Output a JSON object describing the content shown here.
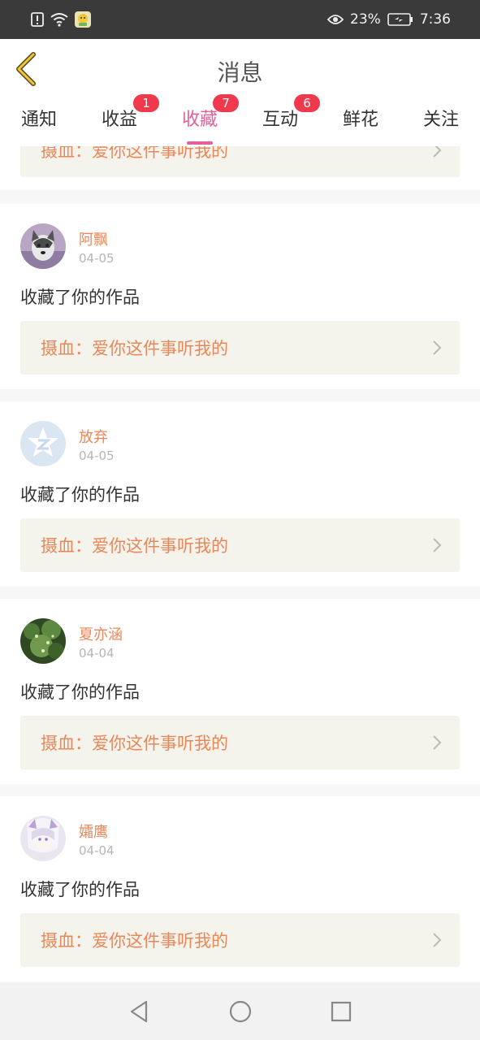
{
  "status_bar": {
    "battery": "23%",
    "time": "7:36",
    "icons": [
      "alert-icon",
      "wifi-icon",
      "app-notification-icon",
      "eye-icon",
      "battery-icon"
    ]
  },
  "header": {
    "title": "消息",
    "back_icon": "back-chevron-icon"
  },
  "tabs": [
    {
      "label": "通知",
      "badge": ""
    },
    {
      "label": "收益",
      "badge": "1"
    },
    {
      "label": "收藏",
      "badge": "7",
      "active": true
    },
    {
      "label": "互动",
      "badge": "6"
    },
    {
      "label": "鲜花",
      "badge": ""
    },
    {
      "label": "关注",
      "badge": ""
    }
  ],
  "partial_item": {
    "ref_text": "摄血：爱你这件事听我的"
  },
  "items": [
    {
      "name": "阿飘",
      "date": "04-05",
      "action": "收藏了你的作品",
      "ref_text": "摄血：爱你这件事听我的"
    },
    {
      "name": "放弃",
      "date": "04-05",
      "action": "收藏了你的作品",
      "ref_text": "摄血：爱你这件事听我的"
    },
    {
      "name": "夏亦涵",
      "date": "04-04",
      "action": "收藏了你的作品",
      "ref_text": "摄血：爱你这件事听我的"
    },
    {
      "name": "孀鹰",
      "date": "04-04",
      "action": "收藏了你的作品",
      "ref_text": "摄血：爱你这件事听我的"
    }
  ],
  "nav_bar": {
    "icons": [
      "nav-back-icon",
      "nav-home-icon",
      "nav-recents-icon"
    ]
  },
  "colors": {
    "accent": "#e3619a",
    "badge": "#f0394d",
    "username": "#e8885a",
    "ref_bg": "#f4f3ec"
  }
}
